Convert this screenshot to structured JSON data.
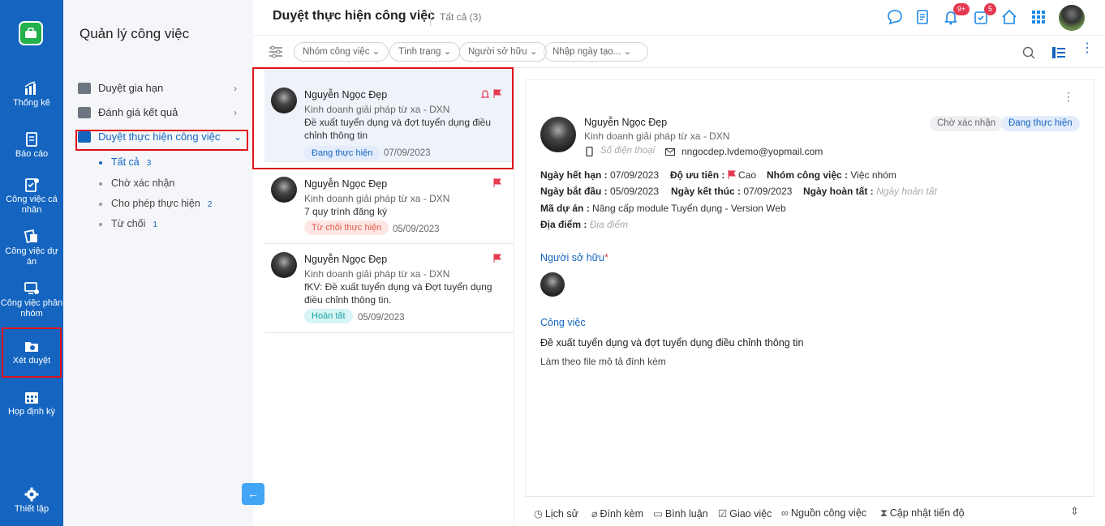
{
  "rail": {
    "items": [
      {
        "label": "Thống kê",
        "icon": "chart-icon"
      },
      {
        "label": "Báo cáo",
        "icon": "report-icon"
      },
      {
        "label": "Công việc cá nhân",
        "icon": "personal-task-icon"
      },
      {
        "label": "Công việc dự án",
        "icon": "project-task-icon"
      },
      {
        "label": "Công việc phân nhóm",
        "icon": "group-task-icon"
      },
      {
        "label": "Xét duyệt",
        "icon": "approval-icon"
      },
      {
        "label": "Họp định kỳ",
        "icon": "calendar-icon"
      },
      {
        "label": "Thiết lập",
        "icon": "gear-icon"
      }
    ]
  },
  "sidebar": {
    "title": "Quản lý công việc",
    "menu": [
      {
        "label": "Duyệt gia hạn"
      },
      {
        "label": "Đánh giá kết quả"
      },
      {
        "label": "Duyệt thực hiện công việc"
      }
    ],
    "submenu": [
      {
        "label": "Tất cả",
        "count": "3"
      },
      {
        "label": "Chờ xác nhận",
        "count": ""
      },
      {
        "label": "Cho phép thực hiện",
        "count": "2"
      },
      {
        "label": "Từ chối",
        "count": "1"
      }
    ]
  },
  "header": {
    "title": "Duyệt thực hiện công việc",
    "count_label": "Tất cả (3)",
    "notif_badge": "9+",
    "task_badge": "5"
  },
  "filters": {
    "group": "Nhóm công việc",
    "status": "Tình trạng",
    "owner": "Người sở hữu",
    "date": "Nhập ngày tạo..."
  },
  "cards": [
    {
      "name": "Nguyễn Ngọc Đẹp",
      "dept": "Kinh doanh giải pháp từ xa - DXN",
      "title": "Đề xuất tuyển dụng và đợt tuyển dụng điều chỉnh thông tin",
      "status": "Đang thực hiện",
      "date": "07/09/2023"
    },
    {
      "name": "Nguyễn Ngọc Đẹp",
      "dept": "Kinh doanh giải pháp từ xa - DXN",
      "title": "7 quy trình đăng ký",
      "status": "Từ chối thực hiện",
      "date": "05/09/2023"
    },
    {
      "name": "Nguyễn Ngọc Đẹp",
      "dept": "Kinh doanh giải pháp từ xa - DXN",
      "title": "fKV: Đề xuất tuyển dụng và Đợt tuyển dụng điều chỉnh thông tin.",
      "status": "Hoàn tất",
      "date": "05/09/2023"
    }
  ],
  "detail": {
    "name": "Nguyễn Ngọc Đẹp",
    "dept": "Kinh doanh giải pháp từ xa - DXN",
    "phone_placeholder": "Số điện thoại",
    "email": "nngocdep.lvdemo@yopmail.com",
    "tag_pending": "Chờ xác nhận",
    "tag_status": "Đang thực hiện",
    "due_label": "Ngày hết hạn :",
    "due": "07/09/2023",
    "priority_label": "Độ ưu tiên :",
    "priority": "Cao",
    "group_label": "Nhóm công việc :",
    "group": "Việc nhóm",
    "start_label": "Ngày bắt đầu :",
    "start": "05/09/2023",
    "end_label": "Ngày kết thúc :",
    "end": "07/09/2023",
    "done_label": "Ngày hoàn tất :",
    "done_placeholder": "Ngày hoàn tất",
    "project_label": "Mã dự án :",
    "project": "Nâng cấp module Tuyển dụng - Version Web",
    "location_label": "Địa điểm :",
    "location_placeholder": "Địa điểm",
    "owner_section": "Người sở hữu",
    "task_section": "Công việc",
    "task_title": "Đề xuất tuyển dụng và đợt tuyển dụng điều chỉnh thông tin",
    "task_desc": "Làm theo file mô tả đính kèm"
  },
  "footer": {
    "history": "Lịch sử",
    "attach": "Đính kèm",
    "comment": "Bình luận",
    "assign": "Giao việc",
    "source": "Nguồn công việc",
    "progress": "Cập nhật tiến độ"
  },
  "colors": {
    "primary": "#1565c0",
    "highlight": "#e0121b",
    "badge": "#e53950"
  }
}
